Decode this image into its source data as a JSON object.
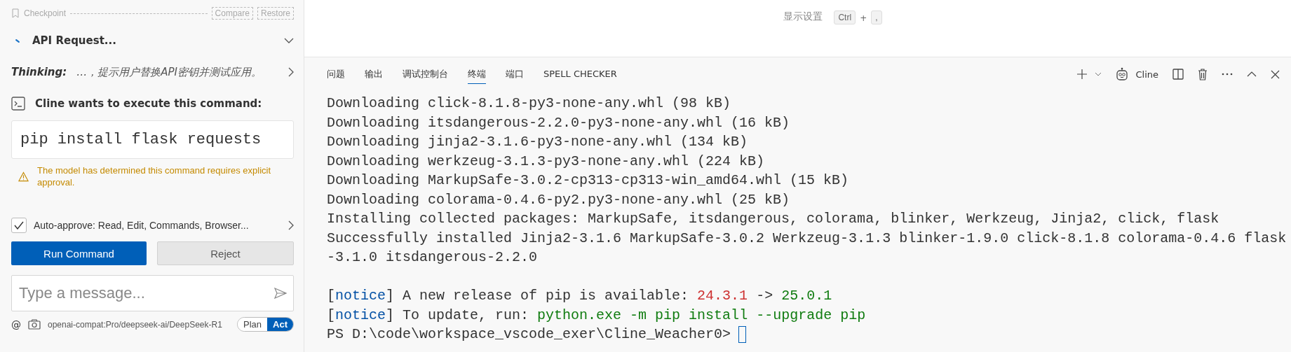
{
  "sidebar": {
    "checkpoint": {
      "label": "Checkpoint",
      "buttons": [
        "Compare",
        "Restore"
      ]
    },
    "api_request": {
      "title": "API Request...",
      "expanded": false
    },
    "thinking": {
      "label": "Thinking:",
      "text": "…，提示用户替换API密钥并测试应用。"
    },
    "command_header": "Cline wants to execute this command:",
    "command": "pip install flask requests",
    "warning": "The model has determined this command requires explicit approval.",
    "auto_approve": {
      "checked": true,
      "label": "Auto-approve: Read, Edit, Commands, Browser..."
    },
    "buttons": [
      {
        "label": "Run Command",
        "kind": "primary"
      },
      {
        "label": "Reject",
        "kind": "secondary"
      }
    ],
    "message": {
      "placeholder": "Type a message..."
    },
    "footer": {
      "at": "@",
      "model": "openai-compat:Pro/deepseek-ai/DeepSeek-R1",
      "modes": [
        {
          "label": "Plan",
          "selected": false
        },
        {
          "label": "Act",
          "selected": true
        }
      ]
    }
  },
  "editor": {
    "hint": "显示设置",
    "keys": [
      "Ctrl",
      ","
    ],
    "plus": "+"
  },
  "panel": {
    "tabs": [
      {
        "label": "问题",
        "selected": false
      },
      {
        "label": "输出",
        "selected": false
      },
      {
        "label": "调试控制台",
        "selected": false
      },
      {
        "label": "终端",
        "selected": true
      },
      {
        "label": "端口",
        "selected": false
      },
      {
        "label": "SPELL CHECKER",
        "selected": false
      }
    ],
    "terminal_name": "Cline",
    "blocks": [
      [
        [
          {
            "text": "Downloading click-8.1.8-py3-none-any.whl (98 kB)"
          }
        ],
        [
          {
            "text": "Downloading itsdangerous-2.2.0-py3-none-any.whl (16 kB)"
          }
        ],
        [
          {
            "text": "Downloading jinja2-3.1.6-py3-none-any.whl (134 kB)"
          }
        ],
        [
          {
            "text": "Downloading werkzeug-3.1.3-py3-none-any.whl (224 kB)"
          }
        ],
        [
          {
            "text": "Downloading MarkupSafe-3.0.2-cp313-cp313-win_amd64.whl (15 kB)"
          }
        ],
        [
          {
            "text": "Downloading colorama-0.4.6-py2.py3-none-any.whl (25 kB)"
          }
        ],
        [
          {
            "text": "Installing collected packages: MarkupSafe, itsdangerous, colorama, blinker, Werkzeug, Jinja2, click, flask"
          }
        ],
        [
          {
            "text": "Successfully installed Jinja2-3.1.6 MarkupSafe-3.0.2 Werkzeug-3.1.3 blinker-1.9.0 click-8.1.8 colorama-0.4.6 flask"
          }
        ],
        [
          {
            "text": "-3.1.0 itsdangerous-2.2.0"
          }
        ]
      ],
      [
        [
          {
            "text": "["
          },
          {
            "text": "notice",
            "color": "#0451a5"
          },
          {
            "text": "] A new release of pip is available: "
          },
          {
            "text": "24.3.1",
            "color": "#cd3131"
          },
          {
            "text": " -> "
          },
          {
            "text": "25.0.1",
            "color": "#107c10"
          }
        ],
        [
          {
            "text": "["
          },
          {
            "text": "notice",
            "color": "#0451a5"
          },
          {
            "text": "] To update, run: "
          },
          {
            "text": "python.exe -m pip install --upgrade pip",
            "color": "#107c10"
          }
        ],
        [
          {
            "text": "PS D:\\code\\workspace_vscode_exer\\Cline_Weacher0>"
          }
        ]
      ]
    ]
  }
}
